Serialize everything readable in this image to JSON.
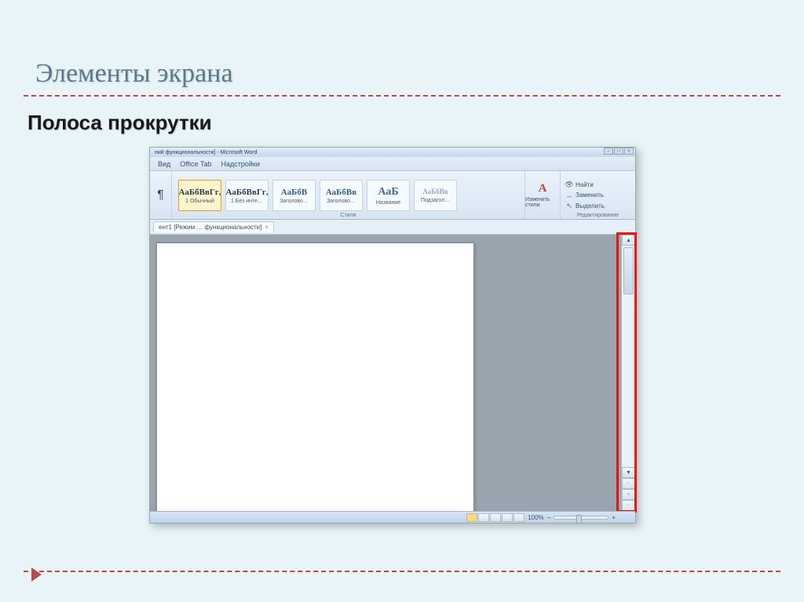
{
  "slide": {
    "title": "Элементы экрана",
    "subtitle": "Полоса прокрутки"
  },
  "word": {
    "titlebar": "ний функциональности] - Microsoft Word",
    "menu": {
      "view": "Вид",
      "office_tab": "Office Tab",
      "addins": "Надстройки"
    },
    "pilcrow": "¶",
    "styles": {
      "normal": {
        "sample": "АаБбВвГг,",
        "name": "1 Обычный"
      },
      "no_spacing": {
        "sample": "АаБбВвГг,",
        "name": "1 Без инте…"
      },
      "heading1": {
        "sample": "АаБбВ",
        "name": "Заголово…"
      },
      "heading2": {
        "sample": "АаБбВв",
        "name": "Заголово…"
      },
      "title": {
        "sample": "АаБ",
        "name": "Название"
      },
      "subtitle": {
        "sample": "АаБбВв",
        "name": "Подзагол…"
      },
      "group_label": "Стили"
    },
    "change_styles": "Изменить стили",
    "editing": {
      "find": "Найти",
      "replace": "Заменить",
      "select": "Выделить",
      "group_label": "Редактирование"
    },
    "doc_tab": "ент1 [Режим … функциональности]",
    "status": {
      "zoom": "100%",
      "minus": "−",
      "plus": "+"
    }
  }
}
